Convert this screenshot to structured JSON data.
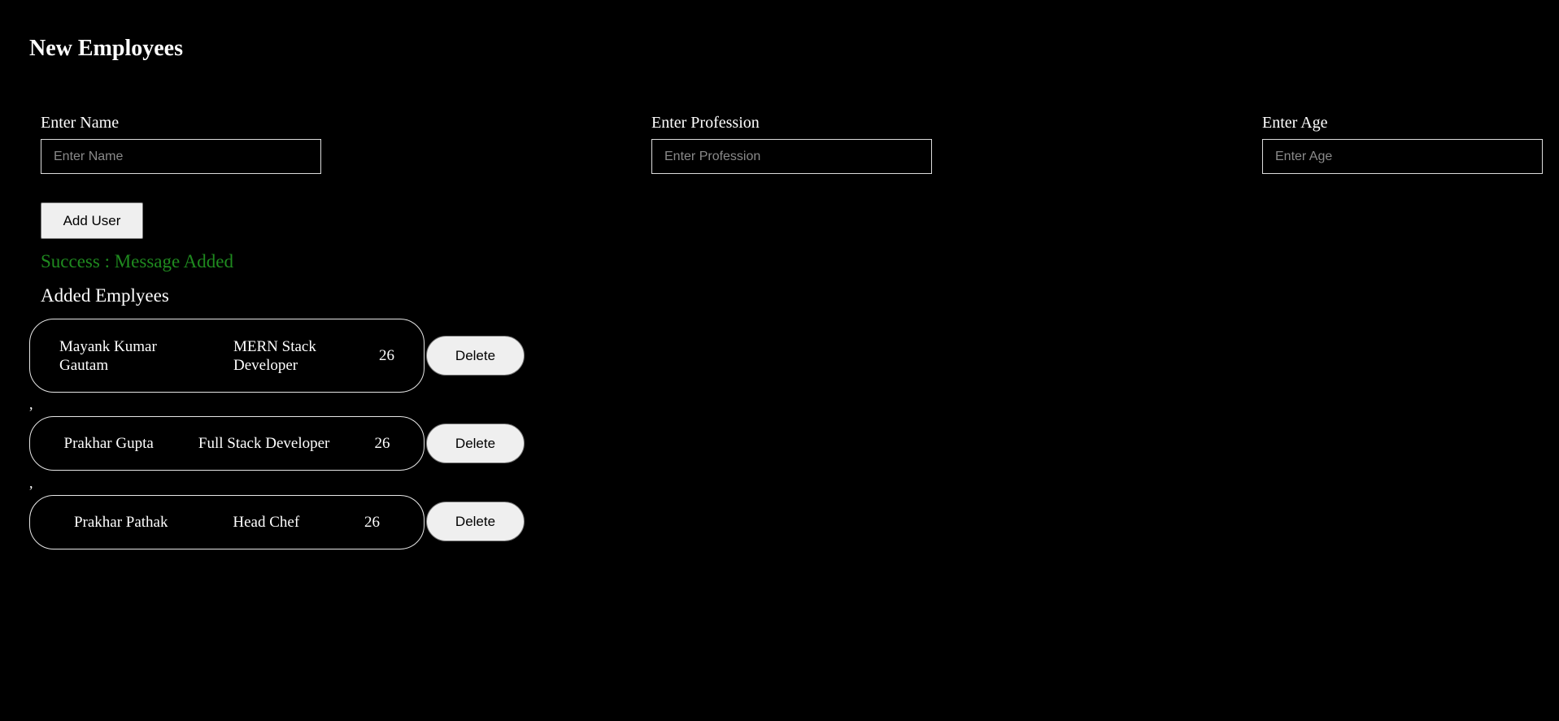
{
  "page": {
    "title": "New Employees"
  },
  "form": {
    "name": {
      "label": "Enter Name",
      "placeholder": "Enter Name",
      "value": ""
    },
    "profession": {
      "label": "Enter Profession",
      "placeholder": "Enter Profession",
      "value": ""
    },
    "age": {
      "label": "Enter Age",
      "placeholder": "Enter Age",
      "value": ""
    },
    "add_button_label": "Add User"
  },
  "status": {
    "message": "Success : Message Added",
    "color": "#1f8a1f"
  },
  "employees": {
    "heading": "Added Emplyees",
    "separator": ",",
    "delete_label": "Delete",
    "items": [
      {
        "name": "Mayank Kumar Gautam",
        "profession": "MERN Stack Developer",
        "age": "26"
      },
      {
        "name": "Prakhar Gupta",
        "profession": "Full Stack Developer",
        "age": "26"
      },
      {
        "name": "Prakhar Pathak",
        "profession": "Head Chef",
        "age": "26"
      }
    ]
  }
}
